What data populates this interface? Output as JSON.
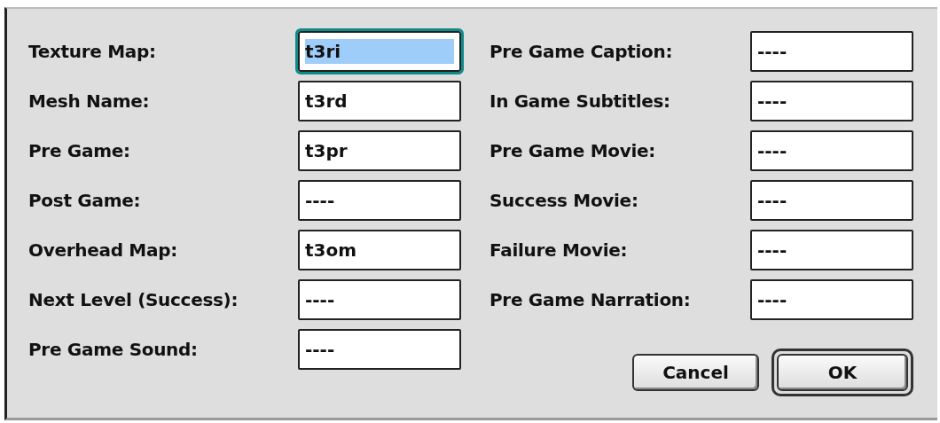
{
  "left_fields": [
    {
      "label": "Texture Map:",
      "value": "t3ri",
      "focused": true
    },
    {
      "label": "Mesh Name:",
      "value": "t3rd",
      "focused": false
    },
    {
      "label": "Pre Game:",
      "value": "t3pr",
      "focused": false
    },
    {
      "label": "Post Game:",
      "value": "----",
      "focused": false
    },
    {
      "label": "Overhead Map:",
      "value": "t3om",
      "focused": false
    },
    {
      "label": "Next Level (Success):",
      "value": "----",
      "focused": false
    },
    {
      "label": "Pre Game Sound:",
      "value": "----",
      "focused": false
    }
  ],
  "right_fields": [
    {
      "label": "Pre Game Caption:",
      "value": "----",
      "focused": false
    },
    {
      "label": "In Game Subtitles:",
      "value": "----",
      "focused": false
    },
    {
      "label": "Pre Game Movie:",
      "value": "----",
      "focused": false
    },
    {
      "label": "Success Movie:",
      "value": "----",
      "focused": false
    },
    {
      "label": "Failure Movie:",
      "value": "----",
      "focused": false
    },
    {
      "label": "Pre Game Narration:",
      "value": "----",
      "focused": false
    }
  ],
  "buttons": [
    {
      "label": "Cancel",
      "default": false
    },
    {
      "label": "OK",
      "default": true
    }
  ]
}
